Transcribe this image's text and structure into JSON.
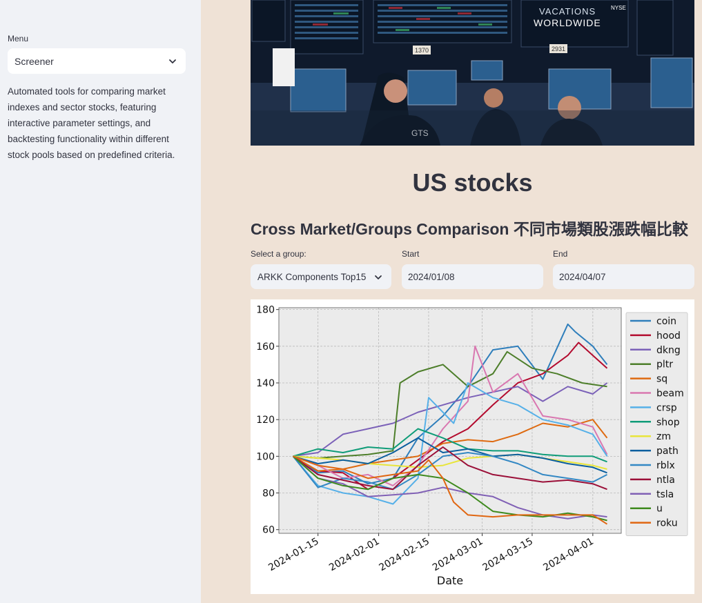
{
  "sidebar": {
    "menu_label": "Menu",
    "menu_selected": "Screener",
    "description": "Automated tools for comparing market indexes and sector stocks, featuring interactive parameter settings, and backtesting functionality within different stock pools based on predefined criteria."
  },
  "main": {
    "title": "US stocks",
    "section_title": "Cross Market/Groups Comparison 不同市場類股漲跌幅比較",
    "group": {
      "label": "Select a group:",
      "value": "ARKK Components Top15"
    },
    "start": {
      "label": "Start",
      "value": "2024/01/08"
    },
    "end": {
      "label": "End",
      "value": "2024/04/07"
    },
    "hero_screen_text": [
      "VACATIONS",
      "WORLDWIDE",
      "NYSE",
      "1370",
      "2931",
      "GTS"
    ]
  },
  "chart_data": {
    "type": "line",
    "xlabel": "Date",
    "ylabel": "",
    "x_range": [
      "2024-01-08",
      "2024-04-05"
    ],
    "ylim": [
      58,
      181
    ],
    "yticks": [
      60,
      80,
      100,
      120,
      140,
      160,
      180
    ],
    "xticks": [
      "2024-01-15",
      "2024-02-01",
      "2024-02-15",
      "2024-03-01",
      "2024-03-15",
      "2024-04-01"
    ],
    "grid": true,
    "legend_position": "right",
    "series": [
      {
        "name": "coin",
        "color": "#2e7ebb",
        "points": [
          [
            "2024-01-08",
            100
          ],
          [
            "2024-01-15",
            91
          ],
          [
            "2024-01-22",
            92
          ],
          [
            "2024-01-29",
            85
          ],
          [
            "2024-02-05",
            88
          ],
          [
            "2024-02-12",
            110
          ],
          [
            "2024-02-19",
            122
          ],
          [
            "2024-02-26",
            138
          ],
          [
            "2024-03-04",
            158
          ],
          [
            "2024-03-11",
            160
          ],
          [
            "2024-03-18",
            142
          ],
          [
            "2024-03-25",
            172
          ],
          [
            "2024-03-27",
            168
          ],
          [
            "2024-04-01",
            160
          ],
          [
            "2024-04-05",
            150
          ]
        ]
      },
      {
        "name": "hood",
        "color": "#b30b2e",
        "points": [
          [
            "2024-01-08",
            100
          ],
          [
            "2024-01-15",
            92
          ],
          [
            "2024-01-22",
            91
          ],
          [
            "2024-01-29",
            82
          ],
          [
            "2024-02-05",
            88
          ],
          [
            "2024-02-12",
            98
          ],
          [
            "2024-02-19",
            108
          ],
          [
            "2024-02-26",
            115
          ],
          [
            "2024-03-04",
            128
          ],
          [
            "2024-03-11",
            140
          ],
          [
            "2024-03-18",
            145
          ],
          [
            "2024-03-25",
            155
          ],
          [
            "2024-03-28",
            162
          ],
          [
            "2024-04-01",
            155
          ],
          [
            "2024-04-05",
            148
          ]
        ]
      },
      {
        "name": "dkng",
        "color": "#7b61b8",
        "points": [
          [
            "2024-01-08",
            100
          ],
          [
            "2024-01-15",
            102
          ],
          [
            "2024-01-22",
            112
          ],
          [
            "2024-01-29",
            115
          ],
          [
            "2024-02-05",
            118
          ],
          [
            "2024-02-12",
            124
          ],
          [
            "2024-02-19",
            128
          ],
          [
            "2024-02-26",
            132
          ],
          [
            "2024-03-04",
            135
          ],
          [
            "2024-03-11",
            138
          ],
          [
            "2024-03-18",
            130
          ],
          [
            "2024-03-25",
            138
          ],
          [
            "2024-04-01",
            134
          ],
          [
            "2024-04-05",
            140
          ]
        ]
      },
      {
        "name": "pltr",
        "color": "#4d7e2a",
        "points": [
          [
            "2024-01-08",
            100
          ],
          [
            "2024-01-15",
            99
          ],
          [
            "2024-01-22",
            100
          ],
          [
            "2024-01-29",
            101
          ],
          [
            "2024-02-05",
            103
          ],
          [
            "2024-02-07",
            140
          ],
          [
            "2024-02-12",
            146
          ],
          [
            "2024-02-19",
            150
          ],
          [
            "2024-02-26",
            138
          ],
          [
            "2024-03-04",
            145
          ],
          [
            "2024-03-08",
            157
          ],
          [
            "2024-03-15",
            148
          ],
          [
            "2024-03-22",
            145
          ],
          [
            "2024-03-29",
            140
          ],
          [
            "2024-04-05",
            138
          ]
        ]
      },
      {
        "name": "sq",
        "color": "#de6a10",
        "points": [
          [
            "2024-01-08",
            100
          ],
          [
            "2024-01-15",
            92
          ],
          [
            "2024-01-22",
            93
          ],
          [
            "2024-01-29",
            96
          ],
          [
            "2024-02-05",
            98
          ],
          [
            "2024-02-12",
            100
          ],
          [
            "2024-02-19",
            107
          ],
          [
            "2024-02-26",
            109
          ],
          [
            "2024-03-04",
            108
          ],
          [
            "2024-03-11",
            112
          ],
          [
            "2024-03-18",
            118
          ],
          [
            "2024-03-25",
            116
          ],
          [
            "2024-04-01",
            120
          ],
          [
            "2024-04-05",
            110
          ]
        ]
      },
      {
        "name": "beam",
        "color": "#d977b0",
        "points": [
          [
            "2024-01-08",
            100
          ],
          [
            "2024-01-15",
            95
          ],
          [
            "2024-01-22",
            88
          ],
          [
            "2024-01-29",
            90
          ],
          [
            "2024-02-05",
            84
          ],
          [
            "2024-02-12",
            95
          ],
          [
            "2024-02-19",
            115
          ],
          [
            "2024-02-26",
            130
          ],
          [
            "2024-02-28",
            160
          ],
          [
            "2024-03-04",
            135
          ],
          [
            "2024-03-11",
            145
          ],
          [
            "2024-03-18",
            122
          ],
          [
            "2024-03-25",
            120
          ],
          [
            "2024-04-01",
            116
          ],
          [
            "2024-04-05",
            101
          ]
        ]
      },
      {
        "name": "crsp",
        "color": "#56b0e8",
        "points": [
          [
            "2024-01-08",
            100
          ],
          [
            "2024-01-15",
            84
          ],
          [
            "2024-01-22",
            80
          ],
          [
            "2024-01-29",
            78
          ],
          [
            "2024-02-05",
            74
          ],
          [
            "2024-02-12",
            88
          ],
          [
            "2024-02-15",
            132
          ],
          [
            "2024-02-22",
            118
          ],
          [
            "2024-02-26",
            140
          ],
          [
            "2024-03-04",
            132
          ],
          [
            "2024-03-11",
            128
          ],
          [
            "2024-03-18",
            120
          ],
          [
            "2024-03-25",
            117
          ],
          [
            "2024-04-01",
            112
          ],
          [
            "2024-04-05",
            100
          ]
        ]
      },
      {
        "name": "shop",
        "color": "#0f9c78",
        "points": [
          [
            "2024-01-08",
            100
          ],
          [
            "2024-01-15",
            104
          ],
          [
            "2024-01-22",
            102
          ],
          [
            "2024-01-29",
            105
          ],
          [
            "2024-02-05",
            104
          ],
          [
            "2024-02-12",
            115
          ],
          [
            "2024-02-19",
            110
          ],
          [
            "2024-02-26",
            104
          ],
          [
            "2024-03-04",
            103
          ],
          [
            "2024-03-11",
            103
          ],
          [
            "2024-03-18",
            101
          ],
          [
            "2024-03-25",
            100
          ],
          [
            "2024-04-01",
            100
          ],
          [
            "2024-04-05",
            97
          ]
        ]
      },
      {
        "name": "zm",
        "color": "#e8e53a",
        "points": [
          [
            "2024-01-08",
            100
          ],
          [
            "2024-01-15",
            99
          ],
          [
            "2024-01-22",
            98
          ],
          [
            "2024-01-29",
            96
          ],
          [
            "2024-02-05",
            95
          ],
          [
            "2024-02-12",
            94
          ],
          [
            "2024-02-19",
            95
          ],
          [
            "2024-02-26",
            99
          ],
          [
            "2024-03-04",
            100
          ],
          [
            "2024-03-11",
            101
          ],
          [
            "2024-03-18",
            99
          ],
          [
            "2024-03-25",
            97
          ],
          [
            "2024-04-01",
            95
          ],
          [
            "2024-04-05",
            93
          ]
        ]
      },
      {
        "name": "path",
        "color": "#0a5e9e",
        "points": [
          [
            "2024-01-08",
            100
          ],
          [
            "2024-01-15",
            96
          ],
          [
            "2024-01-22",
            98
          ],
          [
            "2024-01-29",
            96
          ],
          [
            "2024-02-05",
            102
          ],
          [
            "2024-02-12",
            110
          ],
          [
            "2024-02-19",
            102
          ],
          [
            "2024-02-26",
            104
          ],
          [
            "2024-03-04",
            100
          ],
          [
            "2024-03-11",
            101
          ],
          [
            "2024-03-18",
            99
          ],
          [
            "2024-03-25",
            96
          ],
          [
            "2024-04-01",
            94
          ],
          [
            "2024-04-05",
            91
          ]
        ]
      },
      {
        "name": "rblx",
        "color": "#3388c4",
        "points": [
          [
            "2024-01-08",
            100
          ],
          [
            "2024-01-15",
            83
          ],
          [
            "2024-01-22",
            88
          ],
          [
            "2024-01-29",
            86
          ],
          [
            "2024-02-05",
            82
          ],
          [
            "2024-02-12",
            90
          ],
          [
            "2024-02-19",
            100
          ],
          [
            "2024-02-26",
            102
          ],
          [
            "2024-03-04",
            100
          ],
          [
            "2024-03-11",
            96
          ],
          [
            "2024-03-18",
            90
          ],
          [
            "2024-03-25",
            88
          ],
          [
            "2024-04-01",
            86
          ],
          [
            "2024-04-05",
            90
          ]
        ]
      },
      {
        "name": "ntla",
        "color": "#9b0f38",
        "points": [
          [
            "2024-01-08",
            100
          ],
          [
            "2024-01-15",
            90
          ],
          [
            "2024-01-22",
            87
          ],
          [
            "2024-01-29",
            84
          ],
          [
            "2024-02-05",
            82
          ],
          [
            "2024-02-12",
            95
          ],
          [
            "2024-02-19",
            105
          ],
          [
            "2024-02-26",
            95
          ],
          [
            "2024-03-04",
            90
          ],
          [
            "2024-03-11",
            88
          ],
          [
            "2024-03-18",
            86
          ],
          [
            "2024-03-25",
            87
          ],
          [
            "2024-04-01",
            85
          ],
          [
            "2024-04-05",
            82
          ]
        ]
      },
      {
        "name": "tsla",
        "color": "#8060b5",
        "points": [
          [
            "2024-01-08",
            100
          ],
          [
            "2024-01-15",
            88
          ],
          [
            "2024-01-22",
            85
          ],
          [
            "2024-01-29",
            78
          ],
          [
            "2024-02-05",
            79
          ],
          [
            "2024-02-12",
            80
          ],
          [
            "2024-02-19",
            83
          ],
          [
            "2024-02-26",
            80
          ],
          [
            "2024-03-04",
            78
          ],
          [
            "2024-03-11",
            72
          ],
          [
            "2024-03-18",
            68
          ],
          [
            "2024-03-25",
            66
          ],
          [
            "2024-04-01",
            68
          ],
          [
            "2024-04-05",
            67
          ]
        ]
      },
      {
        "name": "u",
        "color": "#3e8a1e",
        "points": [
          [
            "2024-01-08",
            100
          ],
          [
            "2024-01-15",
            88
          ],
          [
            "2024-01-22",
            84
          ],
          [
            "2024-01-29",
            82
          ],
          [
            "2024-02-05",
            88
          ],
          [
            "2024-02-12",
            90
          ],
          [
            "2024-02-19",
            88
          ],
          [
            "2024-02-26",
            80
          ],
          [
            "2024-03-04",
            70
          ],
          [
            "2024-03-11",
            68
          ],
          [
            "2024-03-18",
            67
          ],
          [
            "2024-03-25",
            69
          ],
          [
            "2024-04-01",
            67
          ],
          [
            "2024-04-05",
            65
          ]
        ]
      },
      {
        "name": "roku",
        "color": "#e06611",
        "points": [
          [
            "2024-01-08",
            100
          ],
          [
            "2024-01-15",
            95
          ],
          [
            "2024-01-22",
            93
          ],
          [
            "2024-01-29",
            88
          ],
          [
            "2024-02-05",
            90
          ],
          [
            "2024-02-12",
            92
          ],
          [
            "2024-02-15",
            98
          ],
          [
            "2024-02-19",
            88
          ],
          [
            "2024-02-22",
            75
          ],
          [
            "2024-02-26",
            68
          ],
          [
            "2024-03-04",
            67
          ],
          [
            "2024-03-11",
            68
          ],
          [
            "2024-03-18",
            68
          ],
          [
            "2024-03-25",
            68
          ],
          [
            "2024-04-01",
            68
          ],
          [
            "2024-04-05",
            63
          ]
        ]
      }
    ]
  }
}
